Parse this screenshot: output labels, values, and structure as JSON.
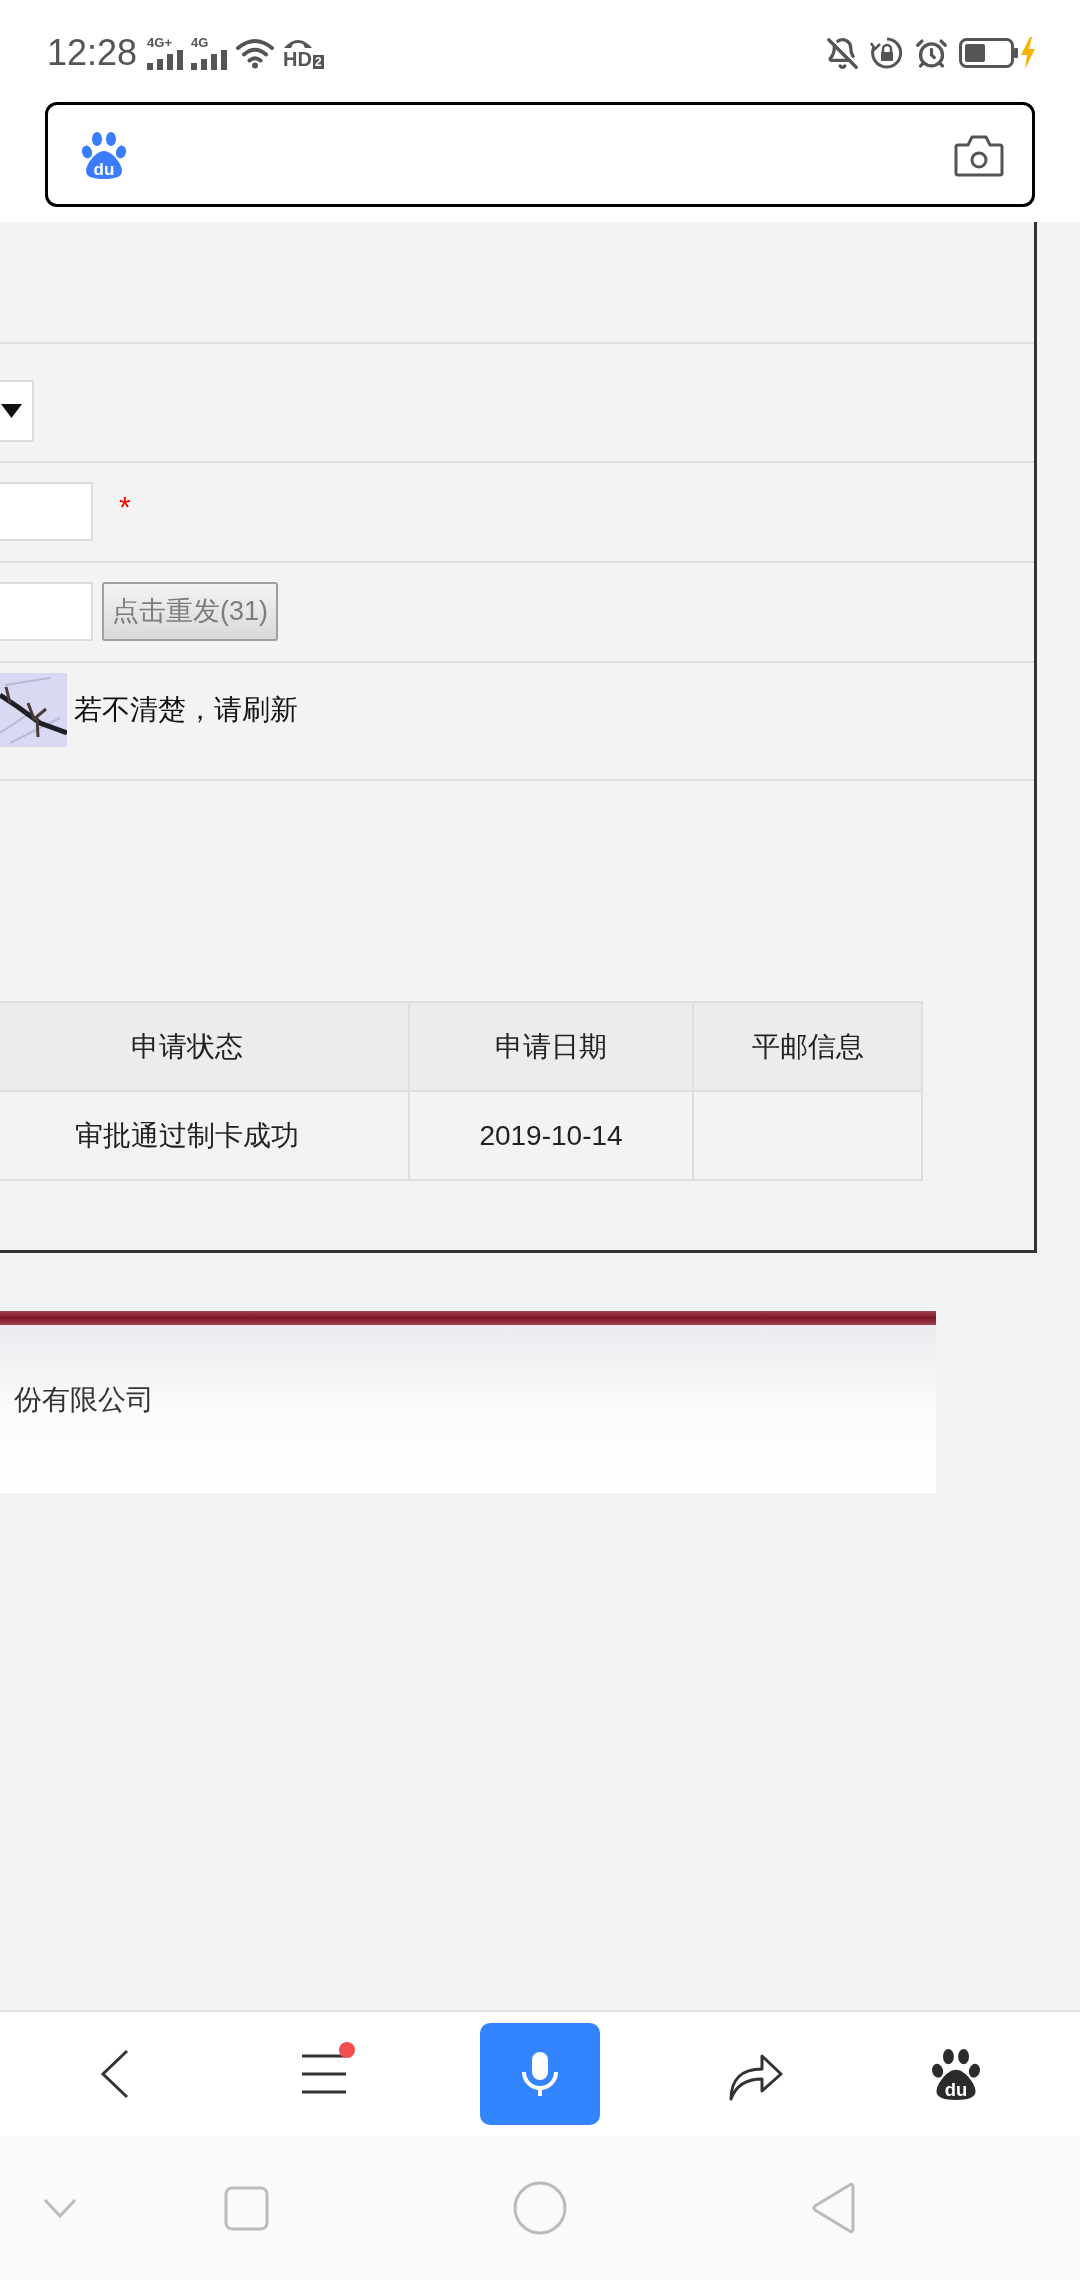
{
  "status_bar": {
    "time": "12:28",
    "networks": [
      "4G+",
      "4G"
    ],
    "call_label": "HD",
    "sim": "2"
  },
  "search_bar": {
    "logo_text": "du"
  },
  "form": {
    "rows": [
      {
        "kind": "select"
      },
      {
        "kind": "input",
        "required_mark": "*"
      },
      {
        "kind": "code",
        "button": {
          "label": "点击重发(31)",
          "disabled": true
        }
      },
      {
        "kind": "captcha",
        "hint": "若不清楚，请刷新"
      }
    ]
  },
  "table": {
    "columns": [
      "申请状态",
      "申请日期",
      "平邮信息"
    ],
    "rows": [
      {
        "cells": [
          "审批通过制卡成功",
          "2019-10-14"
        ]
      }
    ]
  },
  "footer": {
    "company": "份有限公司"
  },
  "toolbar": {
    "menu_notification": true,
    "logo_text": "du"
  }
}
